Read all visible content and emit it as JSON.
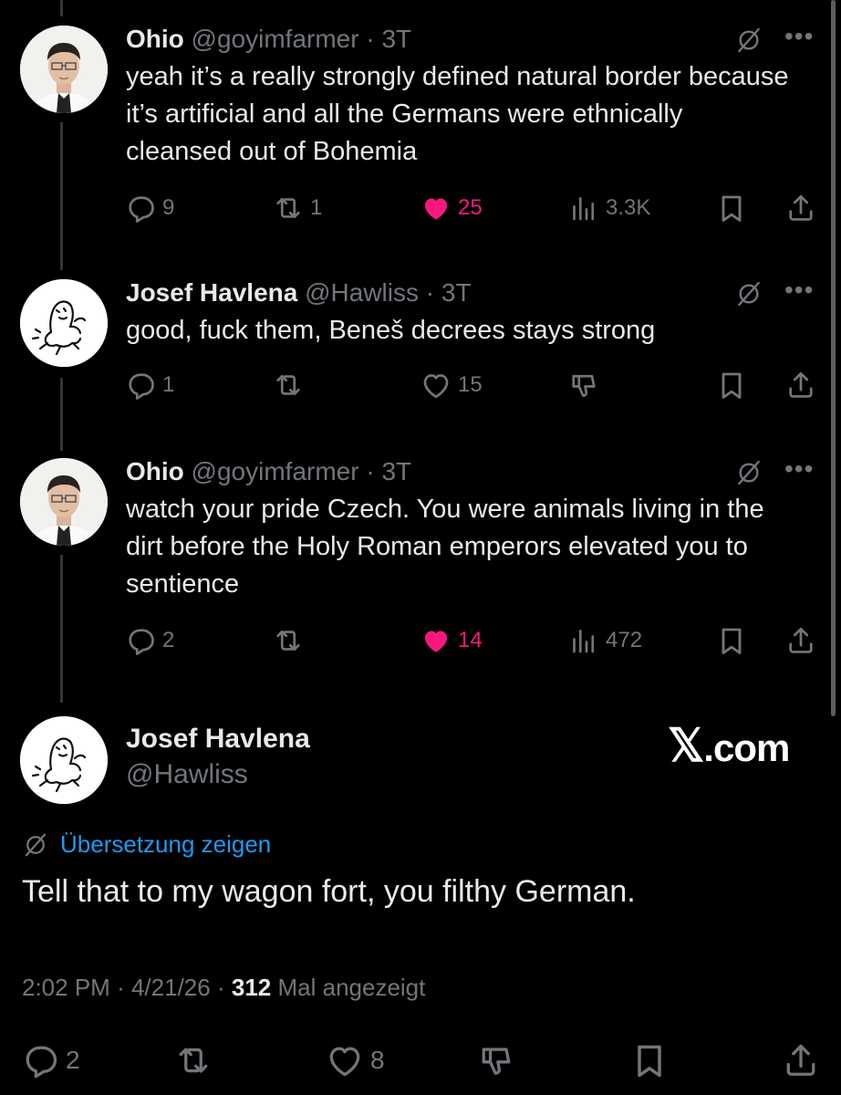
{
  "tweets": [
    {
      "name": "Ohio",
      "handle": "@goyimfarmer",
      "time": "3T",
      "text": "yeah it’s a really strongly defined natural border because it’s artificial and all the Germans were ethnically cleansed out of Bohemia",
      "replies": "9",
      "retweets": "1",
      "likes": "25",
      "liked": true,
      "views": "3.3K"
    },
    {
      "name": "Josef Havlena",
      "handle": "@Hawliss",
      "time": "3T",
      "text": "good, fuck them, Beneš decrees stays strong",
      "replies": "1",
      "retweets": "",
      "likes": "15",
      "liked": false
    },
    {
      "name": "Ohio",
      "handle": "@goyimfarmer",
      "time": "3T",
      "text": "watch your pride Czech. You were animals living in the dirt before the Holy Roman emperors elevated you to sentience",
      "replies": "2",
      "retweets": "",
      "likes": "14",
      "liked": true,
      "views": "472"
    }
  ],
  "main": {
    "name": "Josef Havlena",
    "handle": "@Hawliss",
    "watermark_glyph": "𝕏",
    "watermark_text": ".com",
    "translate_label": "Übersetzung zeigen",
    "text": "Tell that to my wagon fort, you filthy German.",
    "time": "2:02 PM",
    "date": "4/21/26",
    "views": "312",
    "views_label": "Mal angezeigt",
    "replies": "2",
    "likes": "8"
  },
  "separator": "·",
  "more_label": "•••",
  "colors": {
    "background": "#000000",
    "text": "#e7e9ea",
    "muted": "#71767b",
    "like": "#f91880",
    "link": "#1d9bf0"
  },
  "icons": [
    "reply-icon",
    "retweet-icon",
    "heart-icon",
    "views-icon",
    "dislike-icon",
    "bookmark-icon",
    "share-icon",
    "grok-icon",
    "more-icon"
  ]
}
